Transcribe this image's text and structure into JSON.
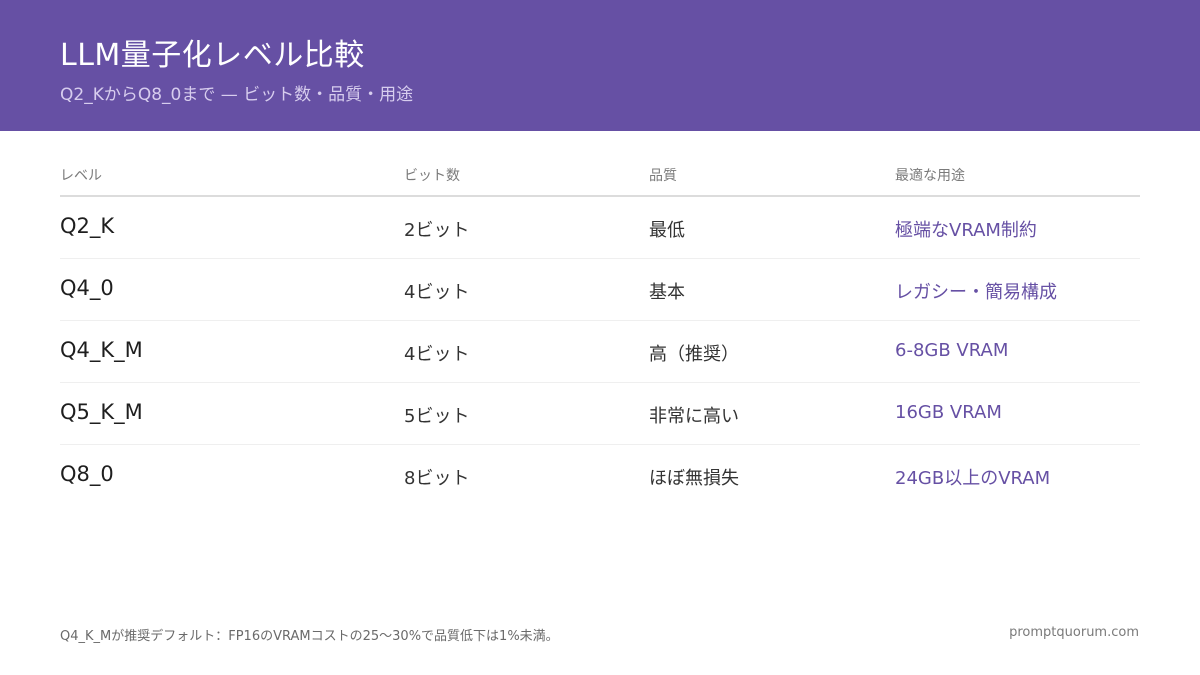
{
  "header": {
    "title": "LLM量子化レベル比較",
    "subtitle": "Q2_KからQ8_0まで — ビット数・品質・用途"
  },
  "table": {
    "columns": [
      "レベル",
      "ビット数",
      "品質",
      "最適な用途"
    ],
    "rows": [
      {
        "level": "Q2_K",
        "bits": "2ビット",
        "quality": "最低",
        "use": "極端なVRAM制約"
      },
      {
        "level": "Q4_0",
        "bits": "4ビット",
        "quality": "基本",
        "use": "レガシー・簡易構成"
      },
      {
        "level": "Q4_K_M",
        "bits": "4ビット",
        "quality": "高（推奨）",
        "use": "6-8GB VRAM"
      },
      {
        "level": "Q5_K_M",
        "bits": "5ビット",
        "quality": "非常に高い",
        "use": "16GB VRAM"
      },
      {
        "level": "Q8_0",
        "bits": "8ビット",
        "quality": "ほぼ無損失",
        "use": "24GB以上のVRAM"
      }
    ]
  },
  "footer": {
    "note": "Q4_K_Mが推奨デフォルト：FP16のVRAMコストの25〜30%で品質低下は1%未満。",
    "site": "promptquorum.com"
  },
  "colors": {
    "header_bg": "#6650a4",
    "accent": "#6650a4"
  }
}
